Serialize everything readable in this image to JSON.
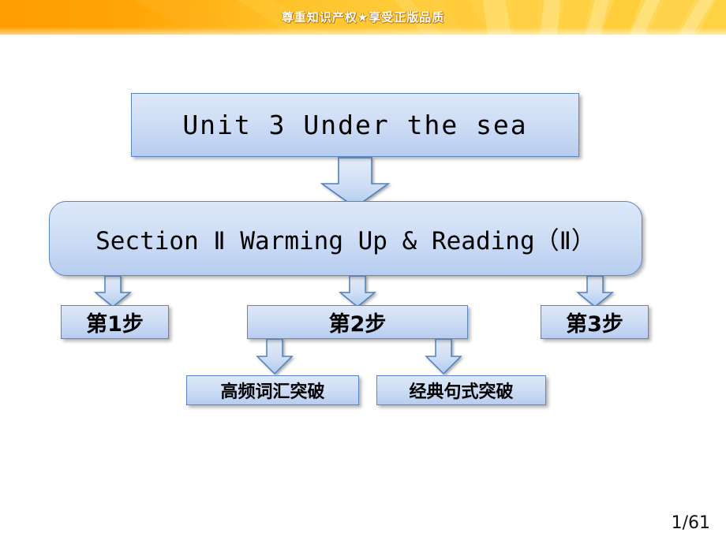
{
  "banner": {
    "text": "尊重知识产权★享受正版品质",
    "bg_color_left": "#ffa200",
    "bg_color_right": "#ffd046"
  },
  "diagram": {
    "type": "flowchart",
    "node_fill_top": "#dde8f9",
    "node_fill_bottom": "#b7cdf0",
    "node_border": "#5b86c4",
    "arrow_fill": "#c6d9f1",
    "arrow_border": "#4f81bd",
    "nodes": {
      "unit": {
        "label": "Unit 3  Under the sea"
      },
      "section": {
        "label": "Section Ⅱ Warming Up & Reading（Ⅱ）"
      },
      "step1": {
        "label": "第1步"
      },
      "step2": {
        "label": "第2步"
      },
      "step3": {
        "label": "第3步"
      },
      "leaf1": {
        "label": "高频词汇突破"
      },
      "leaf2": {
        "label": "经典句式突破"
      }
    },
    "edges": [
      {
        "from": "unit",
        "to": "section"
      },
      {
        "from": "section",
        "to": "step1"
      },
      {
        "from": "section",
        "to": "step2"
      },
      {
        "from": "section",
        "to": "step3"
      },
      {
        "from": "step2",
        "to": "leaf1"
      },
      {
        "from": "step2",
        "to": "leaf2"
      }
    ]
  },
  "footer": {
    "page_indicator": "1/61"
  }
}
